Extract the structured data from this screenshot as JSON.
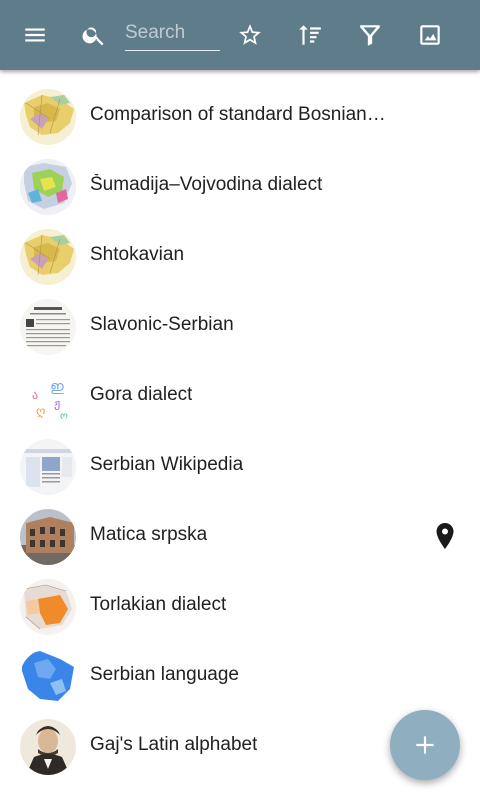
{
  "toolbar": {
    "background": "#5f7c8b",
    "menu_icon": "menu-icon",
    "search_icon": "search-icon",
    "search_placeholder": "Search",
    "search_value": "",
    "favorite_icon": "star-outline-icon",
    "sort_icon": "sort-icon",
    "filter_icon": "filter-icon",
    "image_icon": "image-icon"
  },
  "items": [
    {
      "title": "Comparison of standard Bosnian, Croatian, Montenegrin and Serbian",
      "thumb": "map-balkans-yellow",
      "has_location": false
    },
    {
      "title": "Šumadija–Vojvodina dialect",
      "thumb": "map-dialect-green",
      "has_location": false
    },
    {
      "title": "Shtokavian",
      "thumb": "map-balkans-yellow",
      "has_location": false
    },
    {
      "title": "Slavonic-Serbian",
      "thumb": "old-text-page",
      "has_location": false
    },
    {
      "title": "Gora dialect",
      "thumb": "colorful-letters",
      "has_location": false
    },
    {
      "title": "Serbian Wikipedia",
      "thumb": "website-screenshot",
      "has_location": false
    },
    {
      "title": "Matica srpska",
      "thumb": "building-photo",
      "has_location": true
    },
    {
      "title": "Torlakian dialect",
      "thumb": "map-dialect-orange",
      "has_location": false
    },
    {
      "title": "Serbian language",
      "thumb": "map-blue",
      "has_location": false
    },
    {
      "title": "Gaj's Latin alphabet",
      "thumb": "portrait",
      "has_location": false
    }
  ],
  "location_icon": "map-pin-icon",
  "fab": {
    "icon": "plus-icon",
    "color": "#8faec0"
  }
}
